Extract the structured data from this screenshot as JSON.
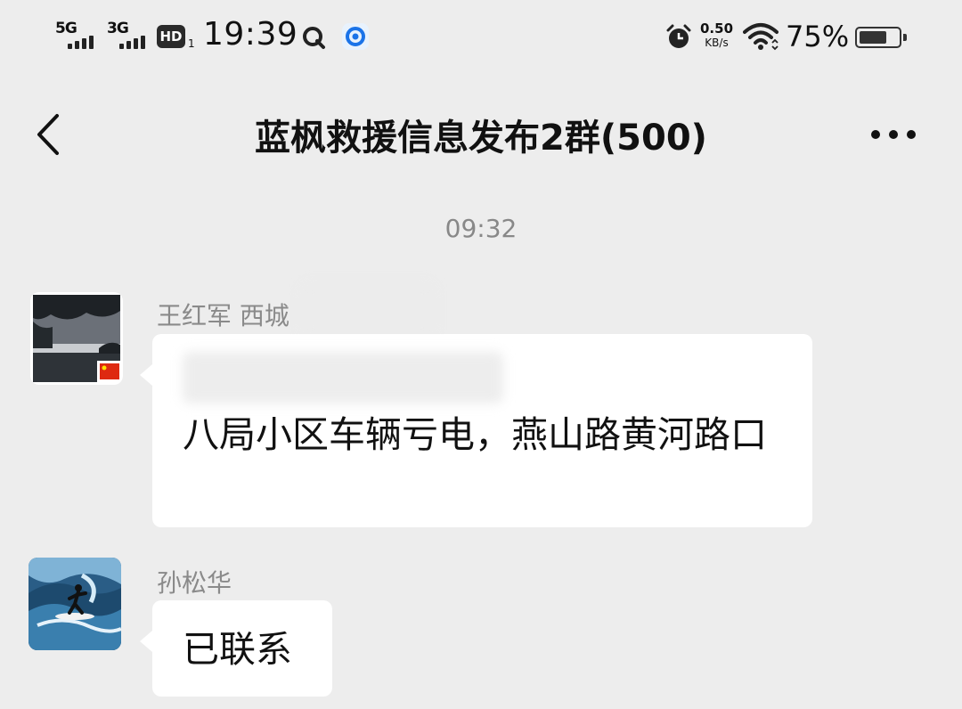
{
  "status_bar": {
    "network_1": "5G",
    "network_2": "3G",
    "hd_badge": "HD",
    "hd_sub": "1",
    "time": "19:39",
    "speed_value": "0.50",
    "speed_unit": "KB/s",
    "battery_percent": "75%",
    "battery_level": 0.75
  },
  "header": {
    "title": "蓝枫救援信息发布2群(500)"
  },
  "chat": {
    "timestamp": "09:32",
    "messages": [
      {
        "sender": "王红军  西城",
        "text": "八局小区车辆亏电，燕山路黄河路口"
      },
      {
        "sender": "孙松华",
        "text": "已联系"
      }
    ]
  },
  "colors": {
    "background": "#ededed",
    "bubble": "#ffffff",
    "sender_text": "#8a8a8a"
  }
}
